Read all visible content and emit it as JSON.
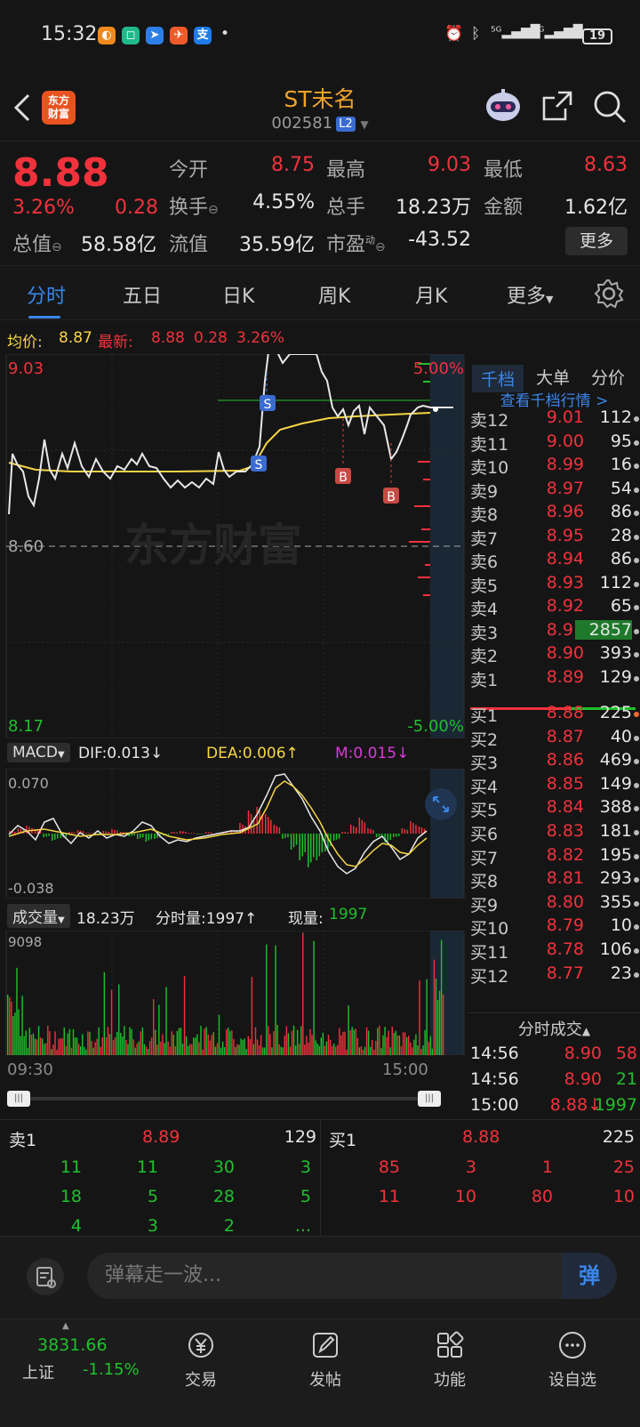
{
  "status": {
    "time": "15:32",
    "battery": "19"
  },
  "header": {
    "logo_line1": "东方",
    "logo_line2": "财富",
    "title": "ST未名",
    "code": "002581",
    "level_badge": "L2"
  },
  "quote": {
    "price": "8.88",
    "change_pct": "3.26%",
    "change": "0.28",
    "labels": {
      "open": "今开",
      "high": "最高",
      "low": "最低",
      "turnover": "换手",
      "volume": "总手",
      "amount": "金额",
      "mktcap": "总值",
      "float": "流值",
      "pe": "市盈",
      "pe_sup": "动"
    },
    "open": "8.75",
    "high": "9.03",
    "low": "8.63",
    "turnover": "4.55%",
    "volume": "18.23万",
    "amount": "1.62亿",
    "mktcap": "58.58亿",
    "float": "35.59亿",
    "pe": "-43.52",
    "more": "更多"
  },
  "tabs": [
    "分时",
    "五日",
    "日K",
    "周K",
    "月K",
    "更多"
  ],
  "avg_bar": {
    "avg_label": "均价:",
    "avg": "8.87",
    "latest_label": "最新:",
    "latest": "8.88",
    "chg": "0.28",
    "pct": "3.26%"
  },
  "chart": {
    "top_price": "9.03",
    "mid_price": "8.60",
    "bottom_price": "8.17",
    "top_pct": "5.00%",
    "bottom_pct": "-5.00%",
    "watermark": "东方财富",
    "tag_sell": "S",
    "tag_buy": "B"
  },
  "macd": {
    "name": "MACD",
    "dif": "DIF:0.013↓",
    "dea": "DEA:0.006↑",
    "m": "M:0.015↓",
    "top": "0.070",
    "bottom": "-0.038"
  },
  "vol": {
    "name": "成交量",
    "total": "18.23万",
    "tick_label": "分时量:1997↑",
    "now_label": "现量:",
    "now": "1997",
    "max": "9098"
  },
  "time_axis": {
    "start": "09:30",
    "end": "15:00"
  },
  "book": {
    "tabs": [
      "千档",
      "大单",
      "分价"
    ],
    "link": "查看千档行情 >",
    "asks": [
      {
        "l": "卖12",
        "p": "9.01",
        "q": "112"
      },
      {
        "l": "卖11",
        "p": "9.00",
        "q": "95"
      },
      {
        "l": "卖10",
        "p": "8.99",
        "q": "16"
      },
      {
        "l": "卖9",
        "p": "8.97",
        "q": "54"
      },
      {
        "l": "卖8",
        "p": "8.96",
        "q": "86"
      },
      {
        "l": "卖7",
        "p": "8.95",
        "q": "28"
      },
      {
        "l": "卖6",
        "p": "8.94",
        "q": "86"
      },
      {
        "l": "卖5",
        "p": "8.93",
        "q": "112"
      },
      {
        "l": "卖4",
        "p": "8.92",
        "q": "65"
      },
      {
        "l": "卖3",
        "p": "8.91",
        "q": "2857"
      },
      {
        "l": "卖2",
        "p": "8.90",
        "q": "393"
      },
      {
        "l": "卖1",
        "p": "8.89",
        "q": "129"
      }
    ],
    "bids": [
      {
        "l": "买1",
        "p": "8.88",
        "q": "225"
      },
      {
        "l": "买2",
        "p": "8.87",
        "q": "40"
      },
      {
        "l": "买3",
        "p": "8.86",
        "q": "469"
      },
      {
        "l": "买4",
        "p": "8.85",
        "q": "149"
      },
      {
        "l": "买5",
        "p": "8.84",
        "q": "388"
      },
      {
        "l": "买6",
        "p": "8.83",
        "q": "181"
      },
      {
        "l": "买7",
        "p": "8.82",
        "q": "195"
      },
      {
        "l": "买8",
        "p": "8.81",
        "q": "293"
      },
      {
        "l": "买9",
        "p": "8.80",
        "q": "355"
      },
      {
        "l": "买10",
        "p": "8.79",
        "q": "10"
      },
      {
        "l": "买11",
        "p": "8.78",
        "q": "106"
      },
      {
        "l": "买12",
        "p": "8.77",
        "q": "23"
      }
    ],
    "ticks_title": "分时成交",
    "ticks": [
      {
        "t": "14:56",
        "p": "8.90",
        "q": "58"
      },
      {
        "t": "14:56",
        "p": "8.90",
        "q": "21"
      },
      {
        "t": "15:00",
        "p": "8.88↓",
        "q": "1997"
      }
    ]
  },
  "five": {
    "ask_label": "卖1",
    "ask_price": "8.89",
    "ask_qty": "129",
    "bid_label": "买1",
    "bid_price": "8.88",
    "bid_qty": "225",
    "ask_grid": [
      [
        "11",
        "11",
        "30",
        "3"
      ],
      [
        "18",
        "5",
        "28",
        "5"
      ],
      [
        "4",
        "3",
        "2",
        "..."
      ]
    ],
    "bid_grid": [
      [
        "85",
        "3",
        "1",
        "25"
      ],
      [
        "11",
        "10",
        "80",
        "10"
      ]
    ]
  },
  "comment": {
    "placeholder": "弹幕走一波...",
    "send": "弹"
  },
  "nav": {
    "index_value": "3831.66",
    "index_name": "上证",
    "index_pct": "-1.15%",
    "items": [
      "交易",
      "发帖",
      "功能",
      "设自选"
    ]
  },
  "colors": {
    "up": "#f0323c",
    "down": "#1fc12c",
    "accent": "#3a86e8",
    "avg": "#f5d545"
  }
}
